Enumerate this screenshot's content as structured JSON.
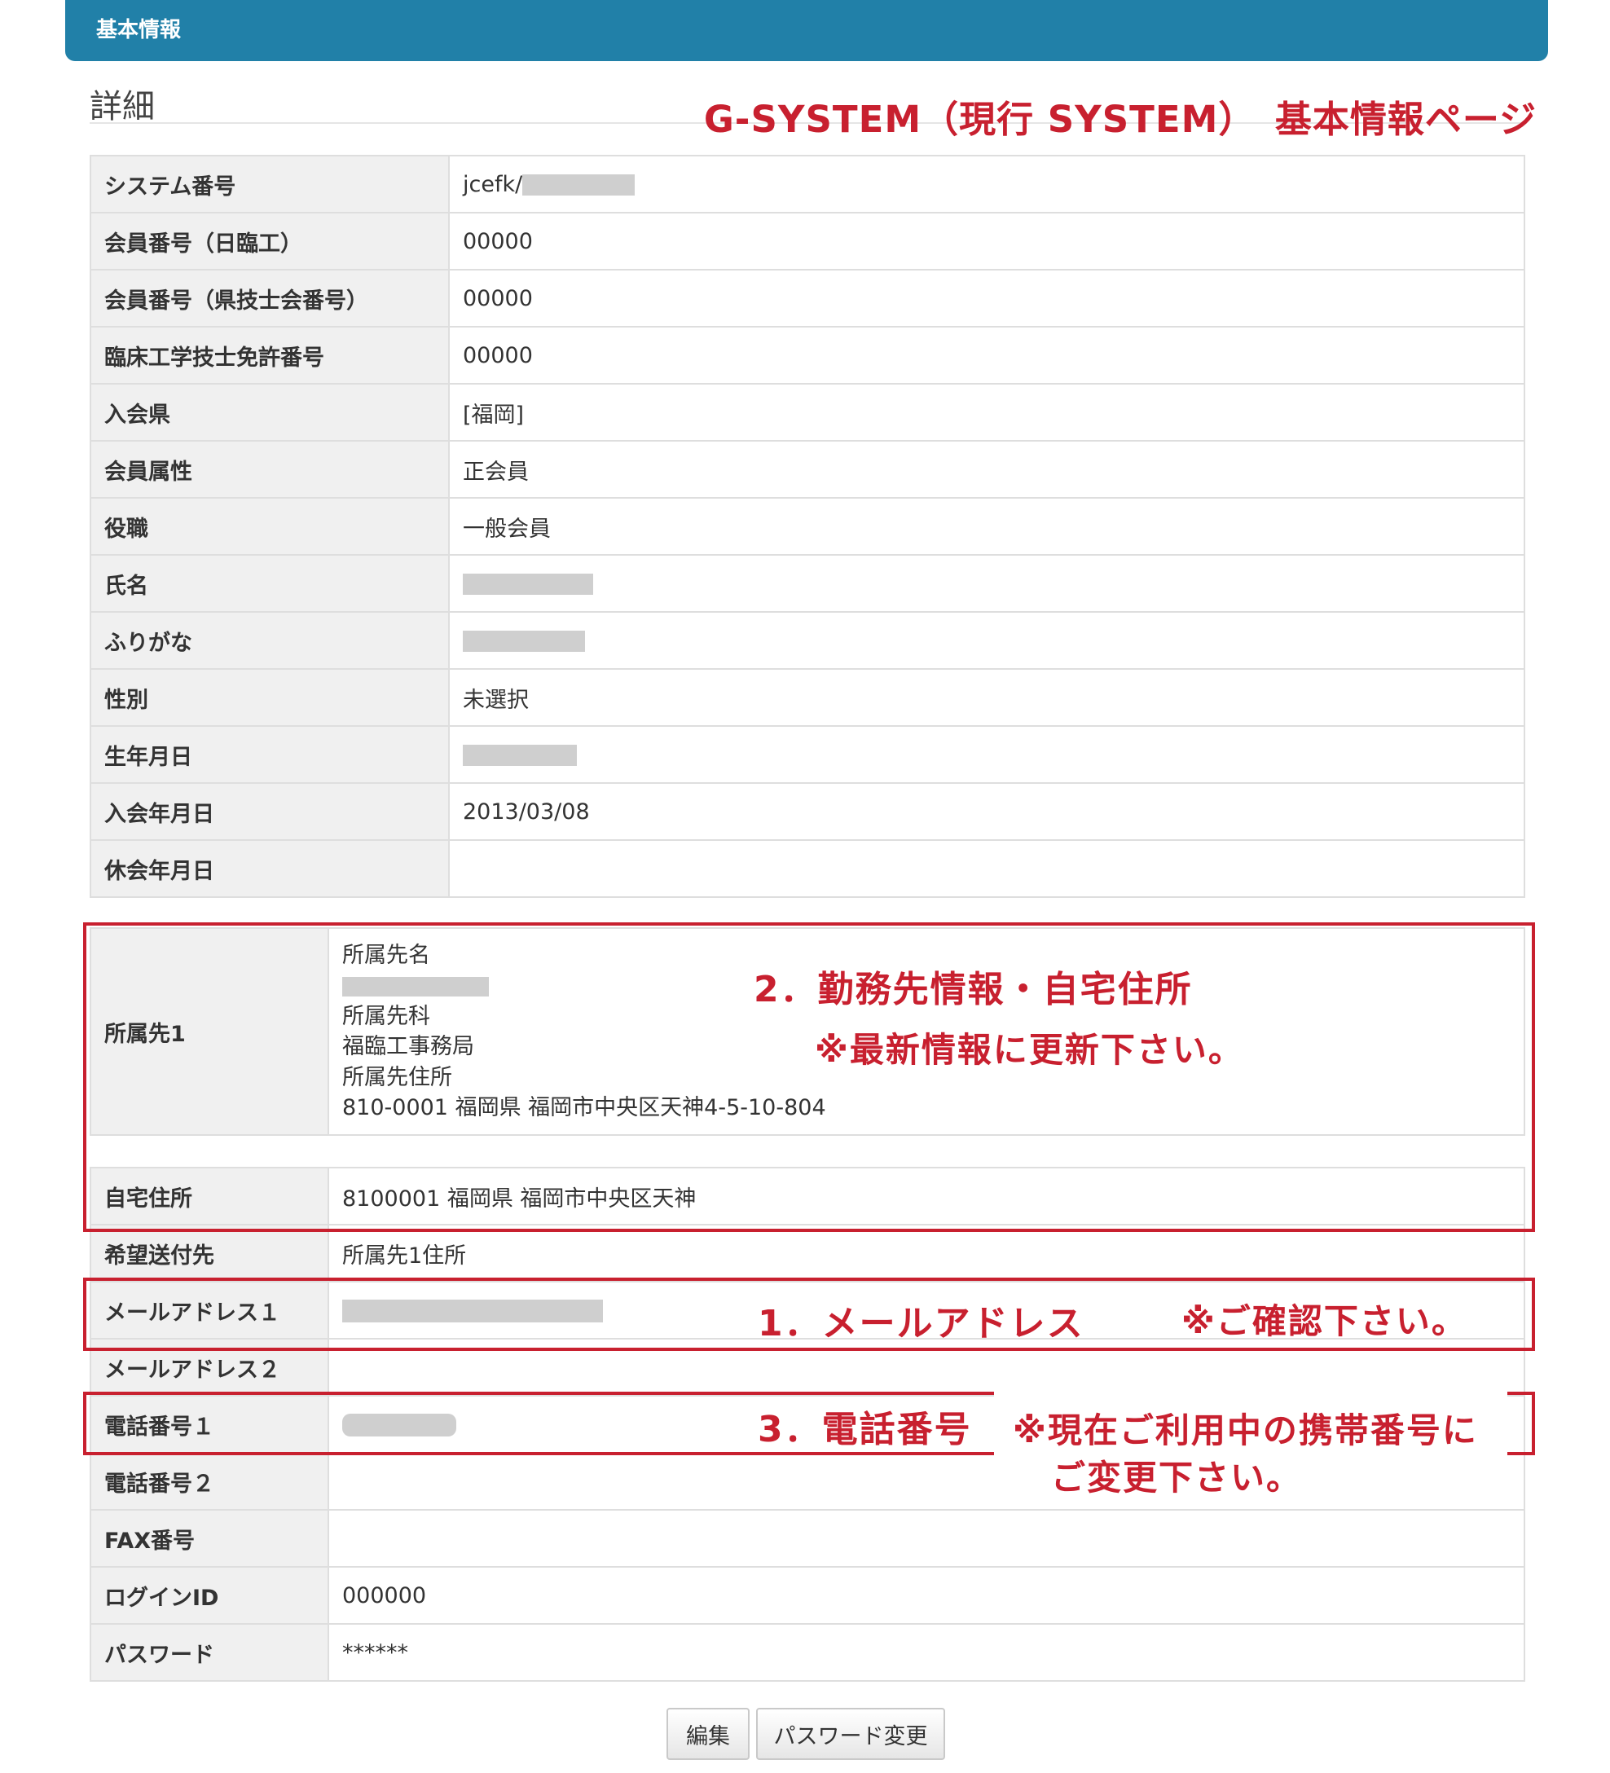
{
  "header": {
    "title": "基本情報"
  },
  "section": {
    "title": "詳細"
  },
  "caption": "G-SYSTEM（現行 SYSTEM）　基本情報ページ",
  "basic_rows": [
    {
      "label": "システム番号",
      "value": "jcefk/"
    },
    {
      "label": "会員番号（日臨工）",
      "value": "00000"
    },
    {
      "label": "会員番号（県技士会番号）",
      "value": "00000"
    },
    {
      "label": "臨床工学技士免許番号",
      "value": "00000"
    },
    {
      "label": "入会県",
      "value": "[福岡]"
    },
    {
      "label": "会員属性",
      "value": "正会員"
    },
    {
      "label": "役職",
      "value": "一般会員"
    },
    {
      "label": "氏名",
      "value": ""
    },
    {
      "label": "ふりがな",
      "value": ""
    },
    {
      "label": "性別",
      "value": "未選択"
    },
    {
      "label": "生年月日",
      "value": ""
    },
    {
      "label": "入会年月日",
      "value": "2013/03/08"
    },
    {
      "label": "休会年月日",
      "value": ""
    }
  ],
  "affiliation": {
    "label": "所属先1",
    "lines": [
      "所属先名",
      "",
      "所属先科",
      "福臨工事務局",
      "所属先住所",
      "810-0001 福岡県 福岡市中央区天神4-5-10-804"
    ]
  },
  "contact_rows": [
    {
      "label": "自宅住所",
      "value": "8100001 福岡県 福岡市中央区天神"
    },
    {
      "label": "希望送付先",
      "value": "所属先1住所"
    },
    {
      "label": "メールアドレス１",
      "value": ""
    },
    {
      "label": "メールアドレス２",
      "value": ""
    },
    {
      "label": "電話番号１",
      "value": ""
    },
    {
      "label": "電話番号２",
      "value": ""
    },
    {
      "label": "FAX番号",
      "value": ""
    },
    {
      "label": "ログインID",
      "value": "000000"
    },
    {
      "label": "パスワード",
      "value": "******"
    }
  ],
  "notes": {
    "workplace": "2．勤務先情報・自宅住所",
    "workplace_sub": "※最新情報に更新下さい。",
    "email": "1．メールアドレス",
    "email_sub": "※ご確認下さい。",
    "phone": "3．電話番号",
    "phone_sub1": "※現在ご利用中の携帯番号に",
    "phone_sub2": "ご変更下さい。"
  },
  "buttons": {
    "edit": "編集",
    "change_password": "パスワード変更"
  }
}
